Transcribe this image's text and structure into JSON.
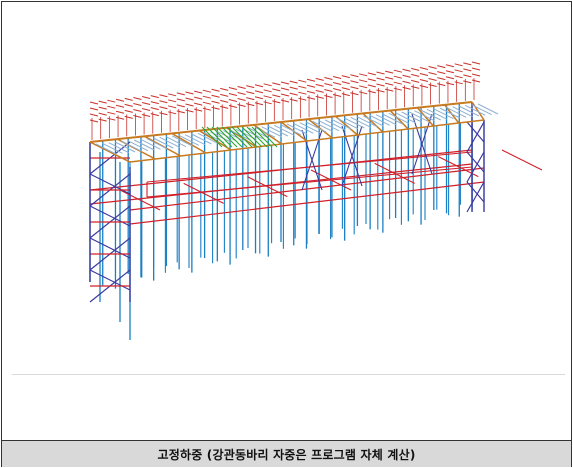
{
  "caption": "고정하중 (강관동바리 자중은 프로그램 자체 계산)",
  "colors": {
    "column": "#1a7fc4",
    "brace": "#3a3aa0",
    "tie": "#d0202a",
    "load_arrow": "#c8302a",
    "girder": "#c87a20",
    "slab_arrow": "#8fb0d0",
    "highlight": "#2aa82a"
  },
  "icons": {
    "structure": "steel-shoring-3d-model-icon"
  }
}
